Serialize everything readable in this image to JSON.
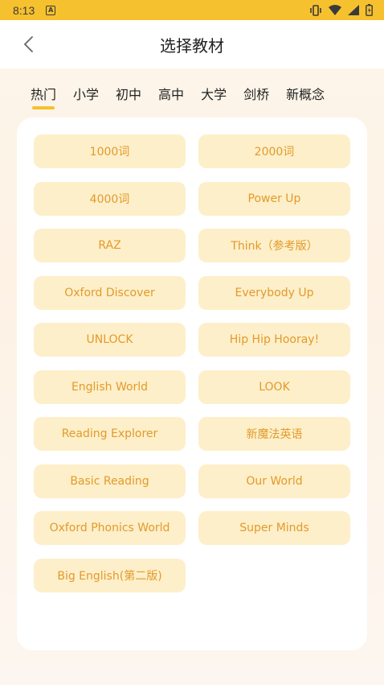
{
  "status": {
    "time": "8:13",
    "notif": "A"
  },
  "header": {
    "title": "选择教材"
  },
  "tabs": [
    {
      "label": "热门",
      "active": true
    },
    {
      "label": "小学"
    },
    {
      "label": "初中"
    },
    {
      "label": "高中"
    },
    {
      "label": "大学"
    },
    {
      "label": "剑桥"
    },
    {
      "label": "新概念"
    }
  ],
  "books": [
    "1000词",
    "2000词",
    "4000词",
    "Power Up",
    "RAZ",
    "Think（参考版）",
    "Oxford Discover",
    "Everybody Up",
    "UNLOCK",
    "Hip Hip Hooray!",
    "English World",
    "LOOK",
    "Reading Explorer",
    "新魔法英语",
    "Basic Reading",
    "Our World",
    "Oxford Phonics World",
    "Super Minds",
    "Big English(第二版)"
  ],
  "colors": {
    "accent": "#f6c12e",
    "button_bg": "#fdefc9",
    "button_text": "#e39a2b"
  }
}
